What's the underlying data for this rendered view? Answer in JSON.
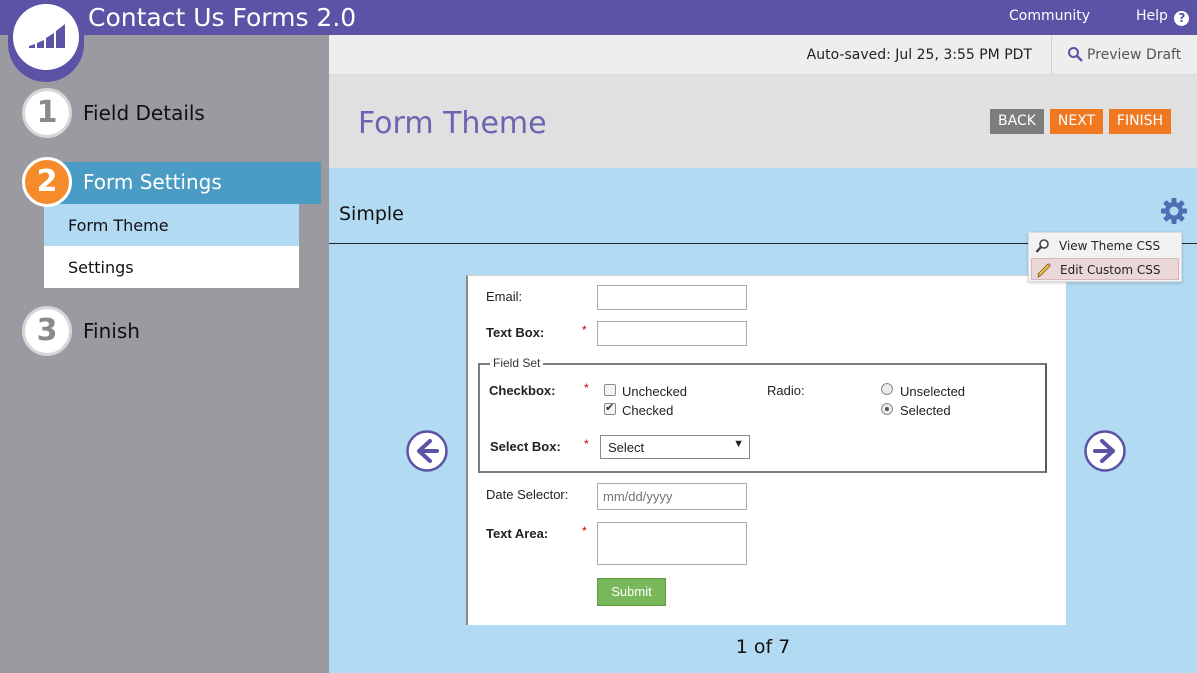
{
  "app": {
    "title": "Contact Us Forms 2.0",
    "links": {
      "community": "Community",
      "help": "Help"
    },
    "accent_color": "#5b53a5"
  },
  "sidebar": {
    "steps": [
      {
        "num": "1",
        "label": "Field Details"
      },
      {
        "num": "2",
        "label": "Form Settings",
        "active": true
      },
      {
        "num": "3",
        "label": "Finish"
      }
    ],
    "substeps": [
      {
        "label": "Form Theme",
        "selected": true
      },
      {
        "label": "Settings",
        "selected": false
      }
    ]
  },
  "toolbar": {
    "autosaved": "Auto-saved: Jul 25, 3:55 PM PDT",
    "preview": "Preview Draft"
  },
  "header": {
    "title": "Form Theme",
    "buttons": {
      "back": "BACK",
      "next": "NEXT",
      "finish": "FINISH"
    }
  },
  "theme": {
    "name": "Simple",
    "menu": {
      "view_css": "View Theme CSS",
      "edit_css": "Edit Custom CSS"
    },
    "pager": "1 of 7"
  },
  "form": {
    "required_mark": "*",
    "email_label": "Email:",
    "textbox_label": "Text Box:",
    "fieldset_legend": "Field Set",
    "checkbox_label": "Checkbox:",
    "checkbox_options": [
      "Unchecked",
      "Checked"
    ],
    "radio_label": "Radio:",
    "radio_options": [
      "Unselected",
      "Selected"
    ],
    "selectbox_label": "Select Box:",
    "select_value": "Select",
    "date_label": "Date Selector:",
    "date_placeholder": "mm/dd/yyyy",
    "textarea_label": "Text Area:",
    "submit_label": "Submit"
  }
}
